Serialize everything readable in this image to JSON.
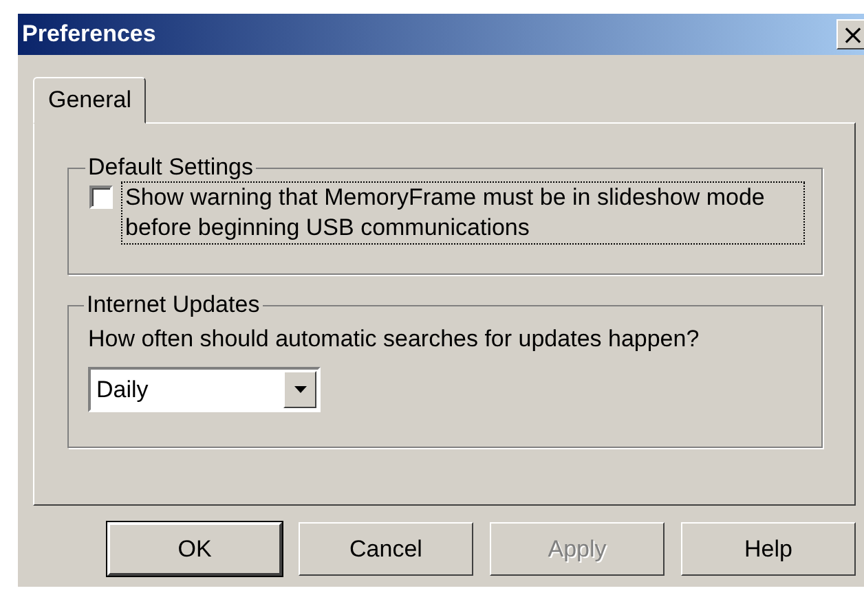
{
  "window": {
    "title": "Preferences",
    "close": "×"
  },
  "tabs": [
    {
      "label": "General",
      "selected": true
    }
  ],
  "default_settings": {
    "legend": "Default Settings",
    "checkbox": {
      "label": "Show warning that MemoryFrame must be in slideshow mode before beginning USB communications",
      "checked": false,
      "focused": true
    }
  },
  "internet_updates": {
    "legend": "Internet Updates",
    "question": "How often should automatic searches for updates happen?",
    "dropdown": {
      "value": "Daily"
    }
  },
  "buttons": [
    {
      "label": "OK",
      "default": true,
      "disabled": false
    },
    {
      "label": "Cancel",
      "default": false,
      "disabled": false
    },
    {
      "label": "Apply",
      "default": false,
      "disabled": true
    },
    {
      "label": "Help",
      "default": false,
      "disabled": false
    }
  ]
}
